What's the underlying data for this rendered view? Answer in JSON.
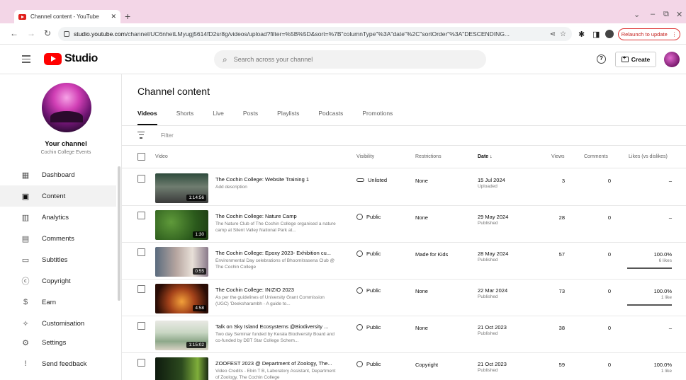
{
  "browser": {
    "tab_title": "Channel content - YouTube",
    "tab_close": "✕",
    "new_tab": "+",
    "url_host": "studio.youtube.com",
    "url_path": "/channel/UC6nhetLMyugj5614fD2sr8g/videos/upload?filter=%5B%5D&sort=%7B\"columnType\"%3A\"date\"%2C\"sortOrder\"%3A\"DESCENDING...",
    "relaunch_label": "Relaunch to update"
  },
  "header": {
    "logo_text": "Studio",
    "search_placeholder": "Search across your channel",
    "help": "?",
    "create_label": "Create"
  },
  "sidebar": {
    "channel_name": "Your channel",
    "channel_sub": "Cochin College Events",
    "items": [
      {
        "label": "Dashboard",
        "icon": "▦"
      },
      {
        "label": "Content",
        "icon": "▣"
      },
      {
        "label": "Analytics",
        "icon": "▥"
      },
      {
        "label": "Comments",
        "icon": "▤"
      },
      {
        "label": "Subtitles",
        "icon": "▭"
      },
      {
        "label": "Copyright",
        "icon": "ⓒ"
      },
      {
        "label": "Earn",
        "icon": "$"
      },
      {
        "label": "Customisation",
        "icon": "✧"
      },
      {
        "label": "Settings",
        "icon": "⚙"
      },
      {
        "label": "Send feedback",
        "icon": "!"
      }
    ]
  },
  "main": {
    "title": "Channel content",
    "tabs": [
      "Videos",
      "Shorts",
      "Live",
      "Posts",
      "Playlists",
      "Podcasts",
      "Promotions"
    ],
    "filter_placeholder": "Filter",
    "columns": {
      "video": "Video",
      "visibility": "Visibility",
      "restrictions": "Restrictions",
      "date": "Date ↓",
      "views": "Views",
      "comments": "Comments",
      "likes": "Likes (vs dislikes)"
    },
    "rows": [
      {
        "title": "The Cochin College: Website Training 1",
        "desc": "Add description",
        "duration": "1:14:56",
        "visibility": "Unlisted",
        "restrictions": "None",
        "date": "15 Jul 2024",
        "date_sub": "Uploaded",
        "views": "3",
        "comments": "0",
        "likes": "–",
        "likes_sub": ""
      },
      {
        "title": "The Cochin College: Nature Camp",
        "desc": "The Nature Club of The Cochin College organised a nature camp at Silent Valley National Park at...",
        "duration": "1:30",
        "visibility": "Public",
        "restrictions": "None",
        "date": "29 May 2024",
        "date_sub": "Published",
        "views": "28",
        "comments": "0",
        "likes": "–",
        "likes_sub": ""
      },
      {
        "title": "The Cochin College: Epoxy 2023- Exhibition cu...",
        "desc": "Environmental Day celebrations of Bhoomitrasena Club @ The Cochin College",
        "duration": "0:55",
        "visibility": "Public",
        "restrictions": "Made for Kids",
        "date": "28 May 2024",
        "date_sub": "Published",
        "views": "57",
        "comments": "0",
        "likes": "100.0%",
        "likes_sub": "6 likes"
      },
      {
        "title": "The Cochin College: INIZIO 2023",
        "desc": "As per the guidelines of University Grant Commission (UGC) 'Deeksharambh - A guide to...",
        "duration": "4:58",
        "visibility": "Public",
        "restrictions": "None",
        "date": "22 Mar 2024",
        "date_sub": "Published",
        "views": "73",
        "comments": "0",
        "likes": "100.0%",
        "likes_sub": "1 like"
      },
      {
        "title": "Talk on Sky Island Ecosystems @Biodiversity ...",
        "desc": "Two day Seminar funded by Kerala Biodiversity Board and co-funded by DBT Star College Schem...",
        "duration": "1:15:02",
        "visibility": "Public",
        "restrictions": "None",
        "date": "21 Oct 2023",
        "date_sub": "Published",
        "views": "38",
        "comments": "0",
        "likes": "–",
        "likes_sub": ""
      },
      {
        "title": "ZOOFEST 2023 @ Department of Zoology, The...",
        "desc": "Video Credits - Ebin T B, Laboratory Assistant, Department of Zoology, The Cochin College",
        "duration": "",
        "visibility": "Public",
        "restrictions": "Copyright",
        "date": "21 Oct 2023",
        "date_sub": "Published",
        "views": "59",
        "comments": "0",
        "likes": "100.0%",
        "likes_sub": "1 like"
      }
    ]
  }
}
